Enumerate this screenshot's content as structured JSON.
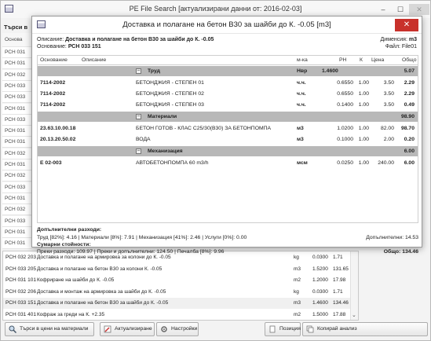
{
  "back_window": {
    "title": "PE File Search [актуализирани данни от: 2016-02-03]",
    "search_label": "Търси в",
    "left_header": "Основа",
    "left_codes": [
      "РСН 031",
      "РСН 031",
      "РСН 032",
      "РСН 033",
      "РСН 033",
      "РСН 031",
      "РСН 033",
      "РСН 031",
      "РСН 031",
      "РСН 032",
      "РСН 031",
      "РСН 032",
      "РСН 033",
      "РСН 031",
      "РСН 032",
      "РСН 033",
      "РСН 031",
      "РСН 031"
    ],
    "list_rows": [
      {
        "code": "РСН 032 203",
        "desc": "Доставка и полагане на армировка за колони до К. -0.05",
        "unit": "kg",
        "qty": "0.0300",
        "price": "1.71"
      },
      {
        "code": "РСН 033 205",
        "desc": "Доставка и полагане на бетон В30 за колони К. -0.05",
        "unit": "m3",
        "qty": "1.5200",
        "price": "131.65"
      },
      {
        "code": "РСН 031 101",
        "desc": "Кофриране на шайби до К. -0.05",
        "unit": "m2",
        "qty": "1.2000",
        "price": "17.98"
      },
      {
        "code": "РСН 032 206",
        "desc": "Доставка и монтаж на армировка за шайби до К. -0.05",
        "unit": "kg",
        "qty": "0.0300",
        "price": "1.71"
      },
      {
        "code": "РСН 033 151",
        "desc": "Доставка и полагане на бетон В30 за шайби до К. -0.05",
        "unit": "m3",
        "qty": "1.4600",
        "price": "134.46"
      },
      {
        "code": "РСН 031 401",
        "desc": "Кофраж за греди на К. +2.35",
        "unit": "m2",
        "qty": "1.5000",
        "price": "17.88"
      }
    ],
    "buttons": {
      "search_materials": "Търси в цени на материали",
      "update": "Актуализиране",
      "settings": "Настройки",
      "position": "Позиция",
      "copy_analysis": "Копирай анализ"
    }
  },
  "dialog": {
    "title": "Доставка и полагане на бетон В30 за шайби до К. -0.05  [m3]",
    "close": "✕",
    "description_label": "Описание:",
    "description_value": "Доставка и полагане на бетон В30 за шайби до К. -0.05",
    "basis_label": "Основание:",
    "basis_value": "РСН 033 151",
    "dimension_label": "Дименсия:",
    "dimension_value": "m3",
    "file_label": "Файл:",
    "file_value": "File01",
    "columns": [
      "Основание",
      "Описание",
      "м-ка",
      "РН",
      "К",
      "Цена",
      "Общо"
    ],
    "groups": [
      {
        "name": "Труд",
        "unit": "Нвр",
        "rn": "1.4600",
        "total": "5.07"
      },
      {
        "name": "Материали",
        "total": "98.90"
      },
      {
        "name": "Механизация",
        "total": "6.00"
      }
    ],
    "rows": [
      [
        {
          "code": "7114-2002",
          "desc": "БЕТОНДЖИЯ - СТЕПЕН 01",
          "unit": "ч.ч.",
          "rn": "0.6550",
          "k": "1.00",
          "price": "3.50",
          "total": "2.29"
        },
        {
          "code": "7114-2002",
          "desc": "БЕТОНДЖИЯ - СТЕПЕН 02",
          "unit": "ч.ч.",
          "rn": "0.6550",
          "k": "1.00",
          "price": "3.50",
          "total": "2.29"
        },
        {
          "code": "7114-2002",
          "desc": "БЕТОНДЖИЯ - СТЕПЕН 03",
          "unit": "ч.ч.",
          "rn": "0.1400",
          "k": "1.00",
          "price": "3.50",
          "total": "0.49"
        }
      ],
      [
        {
          "code": "23.63.10.00.18",
          "desc": "БЕТОН ГОТОВ - КЛАС С25/30(В30) ЗА БЕТОНПОМПА",
          "unit": "м3",
          "rn": "1.0200",
          "k": "1.00",
          "price": "82.00",
          "total": "98.70"
        },
        {
          "code": "20.13.20.50.02",
          "desc": "ВОДА",
          "unit": "м3",
          "rn": "0.1000",
          "k": "1.00",
          "price": "2.00",
          "total": "0.20"
        }
      ],
      [
        {
          "code": "Е 02-003",
          "desc": "АВТОБЕТОНПОМПА 60 m3/h",
          "unit": "мсм",
          "rn": "0.0250",
          "k": "1.00",
          "price": "240.00",
          "total": "6.00"
        }
      ]
    ],
    "footer": {
      "extra_label": "Допълнителни разходи:",
      "extra_detail": "Труд [82%]: 4.16  |  Материали [8%]: 7.91  |  Механизация [41%]: 2.46  |  Услуги [0%]: 0.00",
      "extra_total": "Допълнителни: 14.53",
      "sum_label": "Сумарни стойности:",
      "sum_detail": "Преки разходи: 109.97  |  Преки и допълнителни: 124.50  |  Печалба [8%]: 9.96",
      "grand_total": "Общо: 134.46"
    }
  }
}
